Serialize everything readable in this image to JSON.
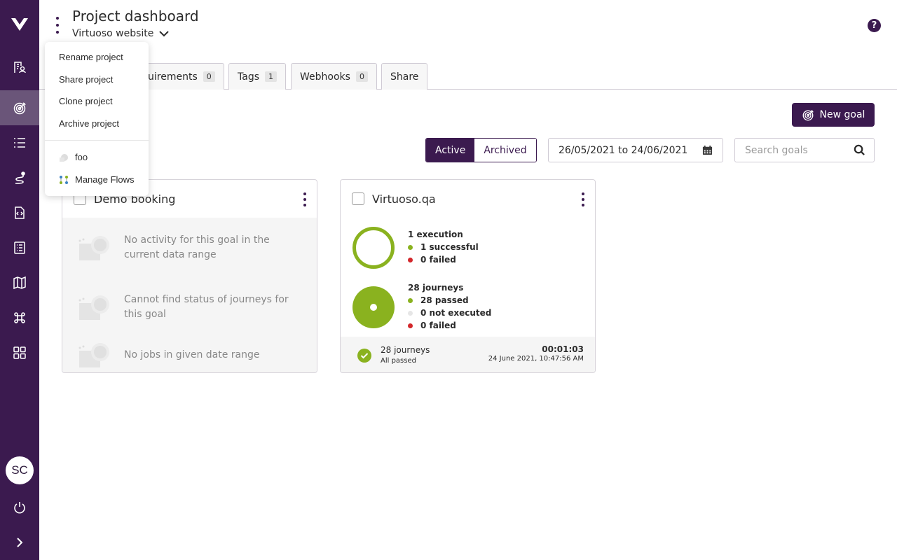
{
  "header": {
    "title": "Project dashboard",
    "project_name": "Virtuoso website"
  },
  "tabs": [
    {
      "label": "uirements",
      "count": "0"
    },
    {
      "label": "Tags",
      "count": "1"
    },
    {
      "label": "Webhooks",
      "count": "0"
    },
    {
      "label": "Share"
    }
  ],
  "toolbar": {
    "new_goal_label": "New goal",
    "active_label": "Active",
    "archived_label": "Archived",
    "date_range": "26/05/2021 to 24/06/2021",
    "search_placeholder": "Search goals"
  },
  "menu": {
    "items": [
      "Rename project",
      "Share project",
      "Clone project",
      "Archive project"
    ],
    "extensions": [
      "foo",
      "Manage Flows"
    ]
  },
  "cards": [
    {
      "title": "Demo booking",
      "empty_messages": [
        "No activity for this goal in the current data range",
        "Cannot find status of journeys for this goal",
        "No jobs in given date range"
      ]
    },
    {
      "title": "Virtuoso.qa",
      "executions": {
        "heading": "1 execution",
        "successful": "1 successful",
        "failed": "0 failed"
      },
      "journeys": {
        "heading": "28 journeys",
        "passed": "28 passed",
        "not_executed": "0 not executed",
        "failed": "0 failed"
      },
      "footer": {
        "journeys": "28 journeys",
        "status": "All passed",
        "duration": "00:01:03",
        "timestamp": "24 June 2021, 10:47:56 AM"
      }
    }
  ],
  "user": {
    "initials": "SC"
  },
  "colors": {
    "brand": "#3b1a4f",
    "success": "#8ab21f",
    "failure": "#d3272b",
    "not_executed": "#e6e6e6"
  }
}
